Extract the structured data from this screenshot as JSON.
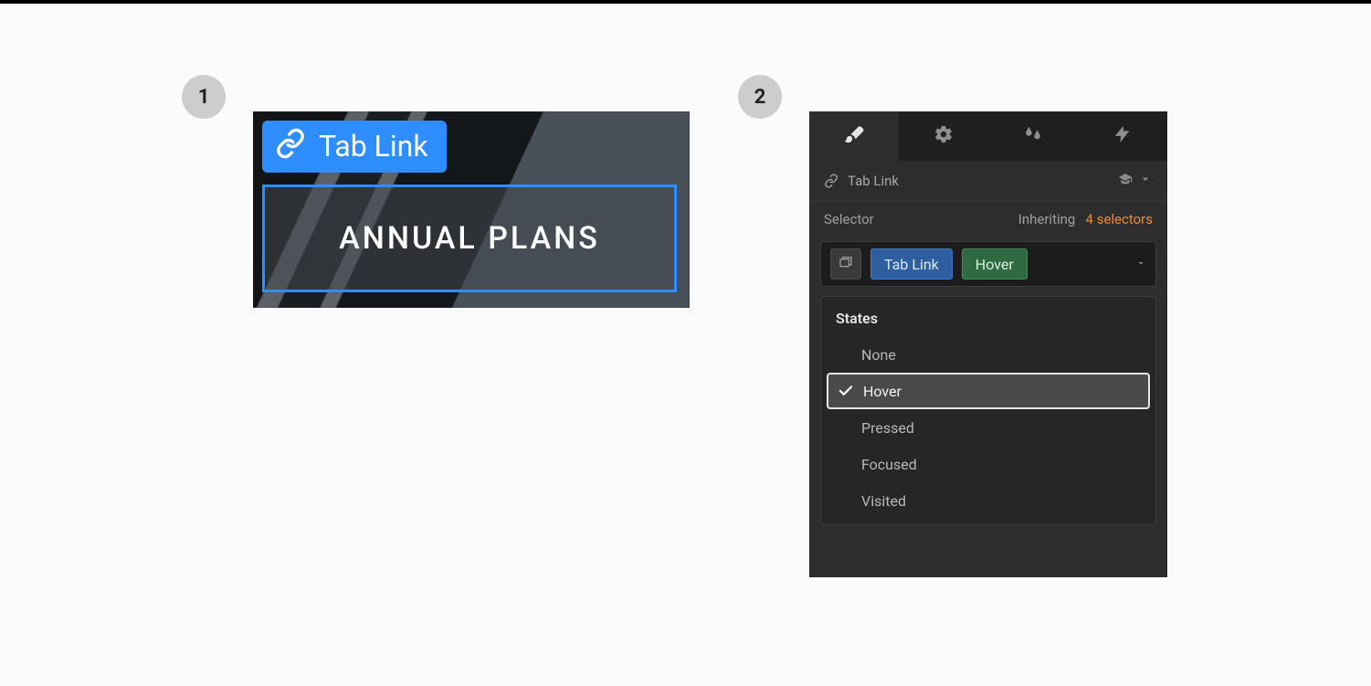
{
  "steps": {
    "one": "1",
    "two": "2"
  },
  "canvas": {
    "tag_label": "Tab Link",
    "selected_text": "ANNUAL PLANS"
  },
  "panel": {
    "breadcrumb": "Tab Link",
    "selector_label": "Selector",
    "inherit_prefix": "Inheriting",
    "inherit_count": "4 selectors",
    "chip_class": "Tab Link",
    "chip_state": "Hover",
    "states_header": "States",
    "states": {
      "none": "None",
      "hover": "Hover",
      "pressed": "Pressed",
      "focused": "Focused",
      "visited": "Visited"
    }
  }
}
